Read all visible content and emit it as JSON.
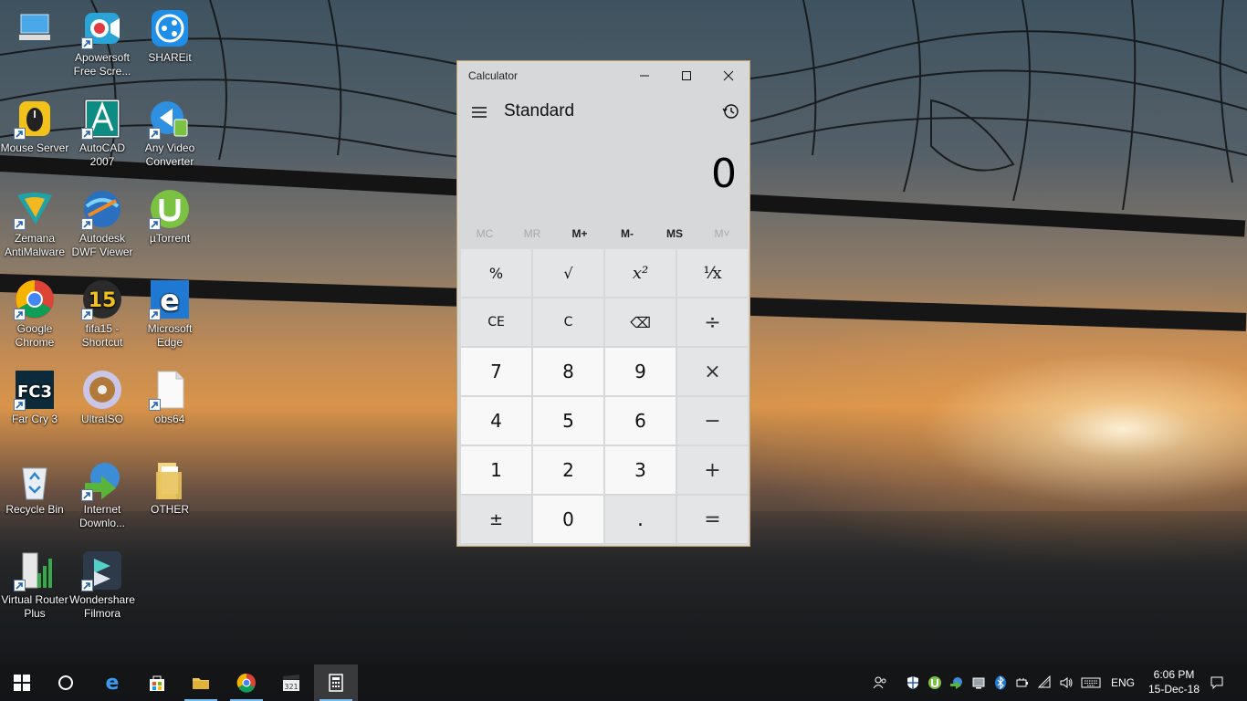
{
  "desktop": {
    "icons": [
      {
        "label": "",
        "icon": "computer-icon"
      },
      {
        "label": "Apowersoft Free Scre...",
        "icon": "apowersoft-icon"
      },
      {
        "label": "SHAREit",
        "icon": "shareit-icon"
      },
      {
        "label": "Mouse Server",
        "icon": "mouse-server-icon"
      },
      {
        "label": "AutoCAD 2007",
        "icon": "autocad-icon"
      },
      {
        "label": "Any Video Converter",
        "icon": "any-video-converter-icon"
      },
      {
        "label": "Zemana AntiMalware",
        "icon": "zemana-icon"
      },
      {
        "label": "Autodesk DWF Viewer",
        "icon": "dwf-viewer-icon"
      },
      {
        "label": "µTorrent",
        "icon": "utorrent-icon"
      },
      {
        "label": "Google Chrome",
        "icon": "chrome-icon"
      },
      {
        "label": "fifa15 - Shortcut",
        "icon": "fifa15-icon"
      },
      {
        "label": "Microsoft Edge",
        "icon": "edge-icon"
      },
      {
        "label": "Far Cry 3",
        "icon": "farcry3-icon"
      },
      {
        "label": "UltraISO",
        "icon": "ultraiso-icon"
      },
      {
        "label": "obs64",
        "icon": "file-icon"
      },
      {
        "label": "Recycle Bin",
        "icon": "recycle-bin-icon"
      },
      {
        "label": "Internet Downlo...",
        "icon": "idm-icon"
      },
      {
        "label": "OTHER",
        "icon": "folder-icon"
      },
      {
        "label": "Virtual Router Plus",
        "icon": "virtual-router-icon"
      },
      {
        "label": "Wondershare Filmora",
        "icon": "filmora-icon"
      }
    ]
  },
  "calculator": {
    "window_title": "Calculator",
    "mode": "Standard",
    "display": "0",
    "memory": [
      "MC",
      "MR",
      "M+",
      "M-",
      "MS",
      "M˅"
    ],
    "keys": [
      "%",
      "√",
      "x²",
      "¹⁄x",
      "CE",
      "C",
      "⌫",
      "÷",
      "7",
      "8",
      "9",
      "×",
      "4",
      "5",
      "6",
      "−",
      "1",
      "2",
      "3",
      "+",
      "±",
      "0",
      ".",
      "="
    ]
  },
  "taskbar": {
    "language": "ENG",
    "time": "6:06 PM",
    "date": "15-Dec-18"
  }
}
